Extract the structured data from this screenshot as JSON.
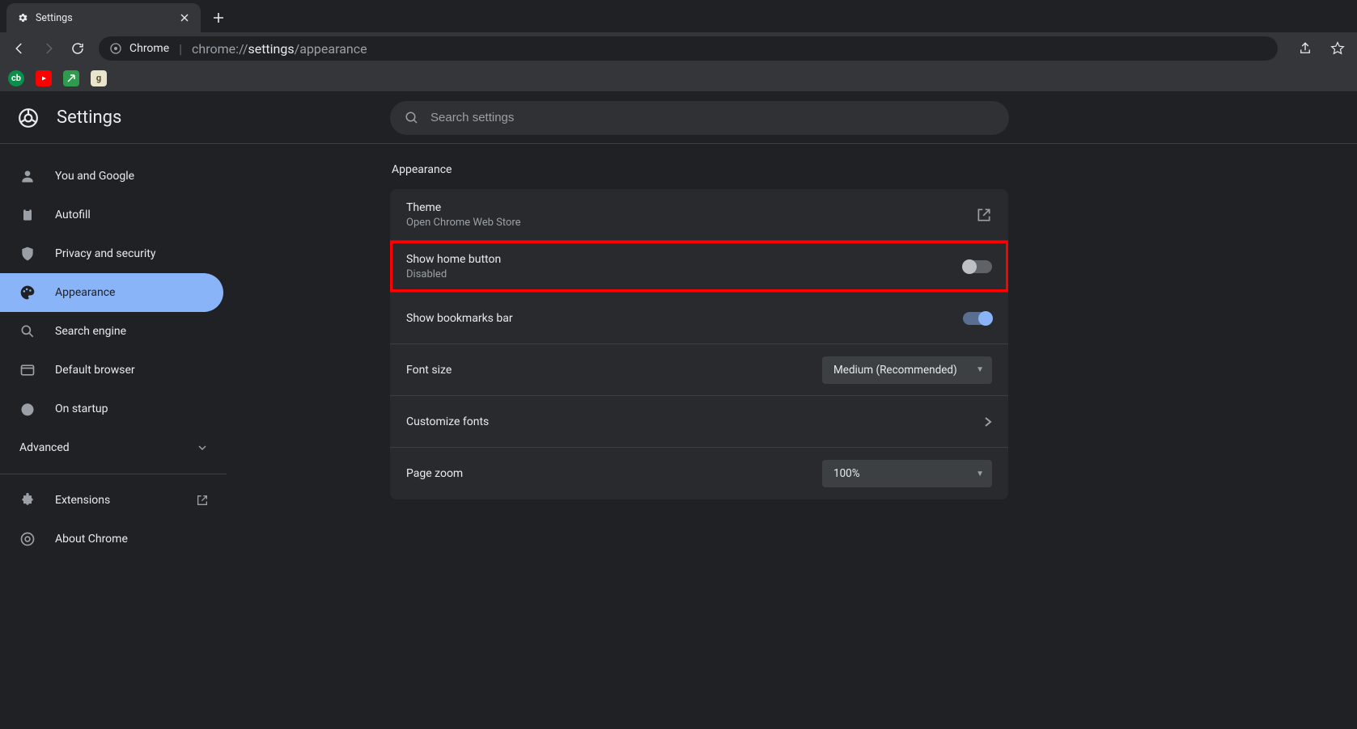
{
  "tab": {
    "title": "Settings"
  },
  "omnibox": {
    "host": "Chrome",
    "url_pre": "chrome://",
    "url_mid": "settings",
    "url_post": "/appearance"
  },
  "header": {
    "title": "Settings"
  },
  "search": {
    "placeholder": "Search settings"
  },
  "sidebar": {
    "items": [
      {
        "label": "You and Google"
      },
      {
        "label": "Autofill"
      },
      {
        "label": "Privacy and security"
      },
      {
        "label": "Appearance"
      },
      {
        "label": "Search engine"
      },
      {
        "label": "Default browser"
      },
      {
        "label": "On startup"
      }
    ],
    "advanced": "Advanced",
    "extensions": "Extensions",
    "about": "About Chrome"
  },
  "section": {
    "title": "Appearance"
  },
  "rows": {
    "theme": {
      "primary": "Theme",
      "secondary": "Open Chrome Web Store"
    },
    "home": {
      "primary": "Show home button",
      "secondary": "Disabled"
    },
    "bookmarks": {
      "primary": "Show bookmarks bar"
    },
    "fontsize": {
      "primary": "Font size",
      "value": "Medium (Recommended)"
    },
    "fonts": {
      "primary": "Customize fonts"
    },
    "zoom": {
      "primary": "Page zoom",
      "value": "100%"
    }
  }
}
